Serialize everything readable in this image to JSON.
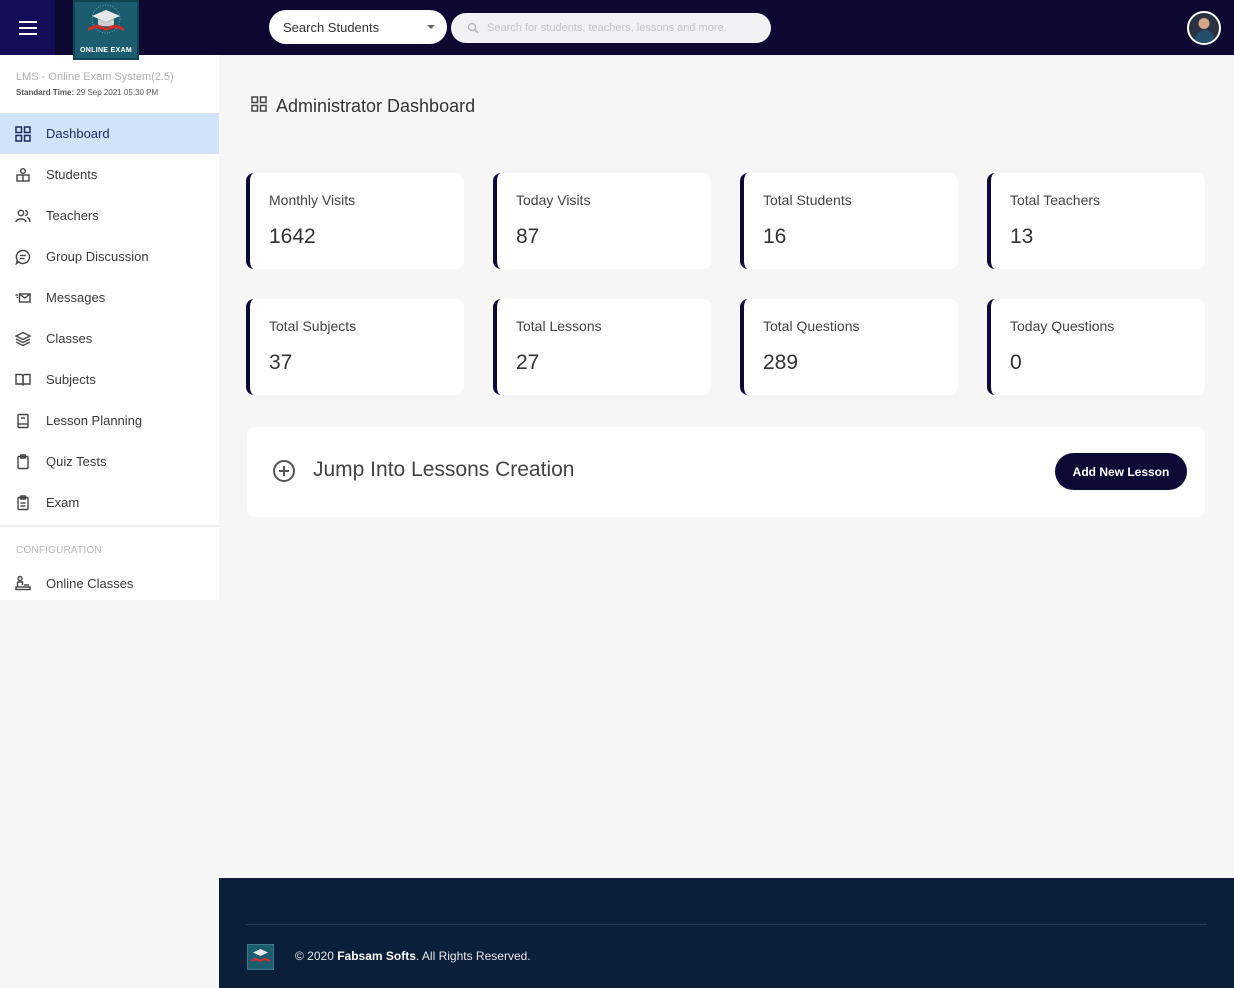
{
  "header": {
    "menu_icon": "hamburger-icon",
    "logo_text": "ONLINE EXAM",
    "search_select": {
      "value": "Search Students",
      "icon": "caret-down-icon"
    },
    "search": {
      "placeholder": "Search for students, teachers, lessons and more.",
      "value": "",
      "icon": "search-icon"
    },
    "avatar_icon": "user-avatar"
  },
  "sidebar": {
    "app_name": "LMS - Online Exam System(2.5)",
    "std_time_label": "Standard Time:",
    "std_time_value": "29 Sep 2021 05:30 PM",
    "items": [
      {
        "label": "Dashboard",
        "icon": "grid-icon",
        "active": true
      },
      {
        "label": "Students",
        "icon": "students-icon"
      },
      {
        "label": "Teachers",
        "icon": "users-icon"
      },
      {
        "label": "Group Discussion",
        "icon": "chat-icon"
      },
      {
        "label": "Messages",
        "icon": "mail-icon"
      },
      {
        "label": "Classes",
        "icon": "layers-icon"
      },
      {
        "label": "Subjects",
        "icon": "book-open-icon"
      },
      {
        "label": "Lesson Planning",
        "icon": "book-icon"
      },
      {
        "label": "Quiz Tests",
        "icon": "clipboard-icon"
      },
      {
        "label": "Exam",
        "icon": "clipboard-list-icon"
      }
    ],
    "config_title": "CONFIGURATION",
    "config_items": [
      {
        "label": "Online Classes",
        "icon": "online-class-icon"
      }
    ]
  },
  "main": {
    "title": "Administrator Dashboard",
    "title_icon": "grid-icon",
    "stats": [
      {
        "label": "Monthly Visits",
        "value": "1642"
      },
      {
        "label": "Today Visits",
        "value": "87"
      },
      {
        "label": "Total Students",
        "value": "16"
      },
      {
        "label": "Total Teachers",
        "value": "13"
      },
      {
        "label": "Total Subjects",
        "value": "37"
      },
      {
        "label": "Total Lessons",
        "value": "27"
      },
      {
        "label": "Total Questions",
        "value": "289"
      },
      {
        "label": "Today Questions",
        "value": "0"
      }
    ],
    "jump": {
      "text": "Jump Into Lessons Creation",
      "icon": "plus-circle-icon",
      "button_label": "Add New Lesson"
    }
  },
  "footer": {
    "copyright_prefix": "© 2020 ",
    "company": "Fabsam Softs",
    "copyright_suffix": ". All Rights Reserved."
  },
  "colors": {
    "topbar": "#0c0831",
    "menu_button": "#130d57",
    "accent": "#0e0a36",
    "active_nav": "#d1e2fb",
    "footer": "#0b1f3b",
    "logo": "#1b5d6e"
  }
}
